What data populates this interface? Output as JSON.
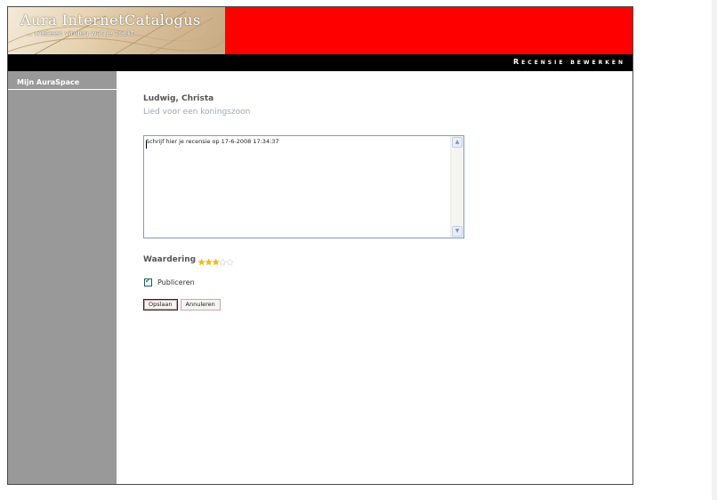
{
  "brand": {
    "title": "Aura InternetCatalogus",
    "subtitle": "... meteen vinden wat je zoekt"
  },
  "header": {
    "page_heading": "Recensie bewerken"
  },
  "sidebar": {
    "items": [
      {
        "label": "Mijn AuraSpace"
      }
    ]
  },
  "book": {
    "author": "Ludwig, Christa",
    "title": "Lied voor een koningszoon"
  },
  "review": {
    "value": "",
    "placeholder": "Schrijf hier je recensie op 17-6-2008 17:34:37"
  },
  "rating": {
    "label": "Waardering",
    "value": 3,
    "max": 5
  },
  "publish": {
    "label": "Publiceren",
    "checked": true
  },
  "actions": {
    "save_label": "Opslaan",
    "cancel_label": "Annuleren"
  },
  "colors": {
    "banner_red": "#ff0000",
    "sidebar_gray": "#999999",
    "star_on": "#f0c000"
  }
}
